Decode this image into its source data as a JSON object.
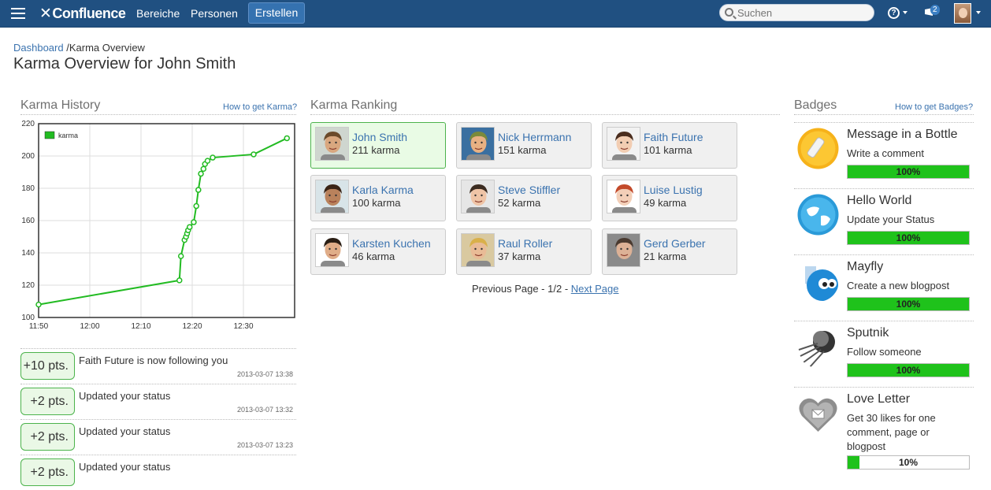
{
  "topbar": {
    "logo": "Confluence",
    "nav": [
      "Bereiche",
      "Personen"
    ],
    "create": "Erstellen",
    "search_placeholder": "Suchen",
    "notifications_count": "2"
  },
  "breadcrumb": {
    "home": "Dashboard",
    "separator": "/",
    "current": "Karma Overview"
  },
  "title": "Karma Overview for John Smith",
  "history": {
    "title": "Karma History",
    "help_link": "How to get Karma?",
    "events": [
      {
        "points": "+10 pts.",
        "text": "Faith Future is now following you",
        "date": "2013-03-07 13:38"
      },
      {
        "points": "+2 pts.",
        "text": "Updated your status",
        "date": "2013-03-07 13:32"
      },
      {
        "points": "+2 pts.",
        "text": "Updated your status",
        "date": "2013-03-07 13:23"
      },
      {
        "points": "+2 pts.",
        "text": "Updated your status",
        "date": ""
      }
    ]
  },
  "chart_data": {
    "type": "line",
    "legend_placement": "top-left",
    "grid": true,
    "x_tick_labels": [
      "11:50",
      "12:00",
      "12:10",
      "12:20",
      "12:30"
    ],
    "x_range_minutes": [
      0,
      50
    ],
    "ylim": [
      100,
      220
    ],
    "y_ticks": [
      100,
      120,
      140,
      160,
      180,
      200,
      220
    ],
    "series": [
      {
        "name": "karma",
        "color": "#22bb22",
        "x": [
          0,
          27.5,
          27.8,
          28.5,
          28.8,
          29.0,
          29.2,
          29.5,
          30.3,
          30.8,
          31.2,
          31.7,
          32.2,
          32.5,
          33.0,
          34.0,
          42.0,
          48.5
        ],
        "y": [
          108,
          123,
          138,
          148,
          150,
          152,
          154,
          156,
          159,
          169,
          179,
          189,
          192,
          195,
          197,
          199,
          201,
          211
        ]
      }
    ]
  },
  "ranking": {
    "title": "Karma Ranking",
    "users": [
      {
        "name": "John Smith",
        "karma": "211 karma",
        "current": true,
        "skin": "#d9a77f",
        "hair": "#6b4a2b",
        "bg": "#cfd6cf"
      },
      {
        "name": "Nick Herrmann",
        "karma": "151 karma",
        "current": false,
        "skin": "#e8b183",
        "hair": "#7a8a3a",
        "bg": "#3a6fa0"
      },
      {
        "name": "Faith Future",
        "karma": "101 karma",
        "current": false,
        "skin": "#f2cdb2",
        "hair": "#4a2d1e",
        "bg": "#f2f2f2"
      },
      {
        "name": "Karla Karma",
        "karma": "100 karma",
        "current": false,
        "skin": "#b9825c",
        "hair": "#3a2416",
        "bg": "#d8e4e8"
      },
      {
        "name": "Steve Stiffler",
        "karma": "52 karma",
        "current": false,
        "skin": "#efc4a6",
        "hair": "#3b2b20",
        "bg": "#e6e6e6"
      },
      {
        "name": "Luise Lustig",
        "karma": "49 karma",
        "current": false,
        "skin": "#f3cfb8",
        "hair": "#c34a2a",
        "bg": "#ffffff"
      },
      {
        "name": "Karsten Kuchen",
        "karma": "46 karma",
        "current": false,
        "skin": "#e0ad88",
        "hair": "#2a1e14",
        "bg": "#ffffff"
      },
      {
        "name": "Raul Roller",
        "karma": "37 karma",
        "current": false,
        "skin": "#e9bb96",
        "hair": "#d9b04a",
        "bg": "#d9c9a0"
      },
      {
        "name": "Gerd Gerber",
        "karma": "21 karma",
        "current": false,
        "skin": "#dcb196",
        "hair": "#4a3a30",
        "bg": "#8a8a8a"
      }
    ],
    "pager": {
      "prev": "Previous Page",
      "sep": " - ",
      "page": "1/2",
      "next": "Next Page"
    }
  },
  "badges": {
    "title": "Badges",
    "help_link": "How to get Badges?",
    "items": [
      {
        "title": "Message in a Bottle",
        "desc": "Write a comment",
        "progress": 1.0,
        "label": "100%",
        "icon": "bottle-icon"
      },
      {
        "title": "Hello World",
        "desc": "Update your Status",
        "progress": 1.0,
        "label": "100%",
        "icon": "globe-icon"
      },
      {
        "title": "Mayfly",
        "desc": "Create a new blogpost",
        "progress": 1.0,
        "label": "100%",
        "icon": "mayfly-icon"
      },
      {
        "title": "Sputnik",
        "desc": "Follow someone",
        "progress": 1.0,
        "label": "100%",
        "icon": "sputnik-icon"
      },
      {
        "title": "Love Letter",
        "desc": "Get 30 likes for one comment, page or blogpost",
        "progress": 0.1,
        "label": "10%",
        "icon": "heart-letter-icon"
      }
    ]
  }
}
